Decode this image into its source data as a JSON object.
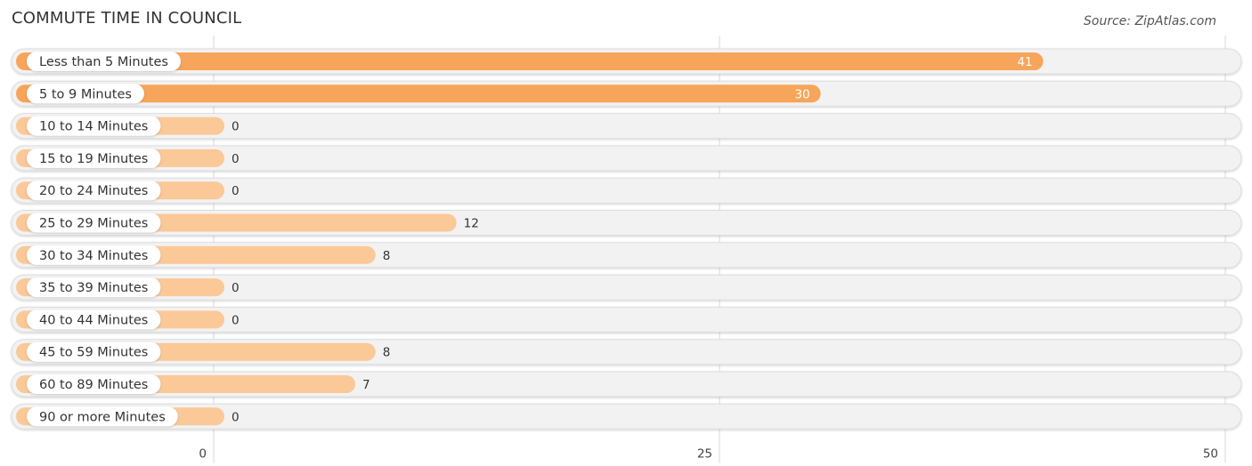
{
  "header": {
    "title": "COMMUTE TIME IN COUNCIL",
    "source": "Source: ZipAtlas.com"
  },
  "chart_data": {
    "type": "bar",
    "orientation": "horizontal",
    "title": "COMMUTE TIME IN COUNCIL",
    "xlabel": "",
    "ylabel": "",
    "categories": [
      "Less than 5 Minutes",
      "5 to 9 Minutes",
      "10 to 14 Minutes",
      "15 to 19 Minutes",
      "20 to 24 Minutes",
      "25 to 29 Minutes",
      "30 to 34 Minutes",
      "35 to 39 Minutes",
      "40 to 44 Minutes",
      "45 to 59 Minutes",
      "60 to 89 Minutes",
      "90 or more Minutes"
    ],
    "values": [
      41,
      30,
      0,
      0,
      0,
      12,
      8,
      0,
      0,
      8,
      7,
      0
    ],
    "xlim": [
      0,
      50
    ],
    "xticks": [
      0,
      25,
      50
    ],
    "grid": true,
    "legend": "none",
    "colors": {
      "bar_strong": "#f7a55a",
      "bar_light": "#fbc898",
      "track": "#f2f2f2",
      "value_inside": "#ffffff",
      "value_outside": "#333333"
    }
  }
}
